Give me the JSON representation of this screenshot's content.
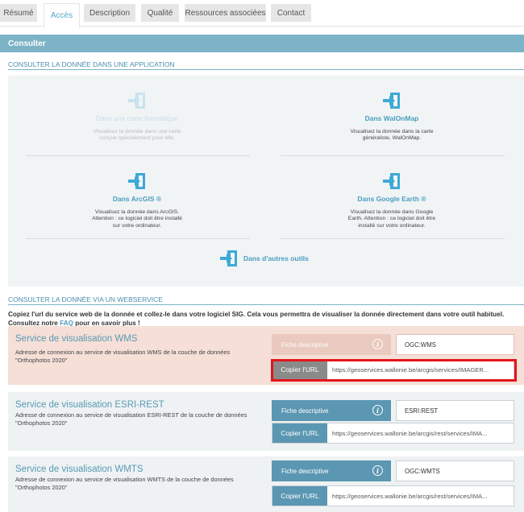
{
  "tabs": [
    {
      "label": "Résumé"
    },
    {
      "label": "Accès"
    },
    {
      "label": "Description"
    },
    {
      "label": "Qualité"
    },
    {
      "label": "Ressources associées"
    },
    {
      "label": "Contact"
    }
  ],
  "consult_bar": "Consulter",
  "section_app": "CONSULTER LA DONNÉE DANS UNE APPLICATION",
  "apps": {
    "thematique": {
      "title": "Dans une carte thématique",
      "desc": "Visualisez la donnée dans une carte conçue spécialement pour elle."
    },
    "walonmap": {
      "title": "Dans WalOnMap",
      "desc": "Visualisez la donnée dans la carte généraliste, WalOnMap."
    },
    "arcgis": {
      "title": "Dans ArcGIS ®",
      "desc": "Visualisez la donnée dans ArcGIS. Attention : ce logiciel doit être installé sur votre ordinateur."
    },
    "google_earth": {
      "title": "Dans Google Earth ®",
      "desc": "Visualisez la donnée dans Google Earth. Attention : ce logiciel doit être installé sur votre ordinateur."
    },
    "autres": {
      "title": "Dans d'autres outils"
    }
  },
  "section_ws": "CONSULTER LA DONNÉE VIA UN WEBSERVICE",
  "intro": {
    "before": "Copiez l'url du service web de la donnée et collez-le dans votre logiciel SIG. Cela vous permettra de visualiser la donnée directement dans votre outil habituel. Consultez notre ",
    "link": "FAQ",
    "after": " pour en savoir plus !"
  },
  "services": {
    "wms": {
      "title": "Service de visualisation WMS",
      "desc": "Adresse de connexion au service de visualisation WMS de la couche de données \"Orthophotos 2020\"",
      "fiche": "Fiche descriptive",
      "type": "OGC:WMS",
      "copy": "Copier l'URL",
      "url": "https://geoservices.wallonie.be/arcgis/services/IMAGER..."
    },
    "esri": {
      "title": "Service de visualisation ESRI-REST",
      "desc": "Adresse de connexion au service de visualisation ESRI-REST de la couche de données \"Orthophotos 2020\"",
      "fiche": "Fiche descriptive",
      "type": "ESRI:REST",
      "copy": "Copier l'URL",
      "url": "https://geoservices.wallonie.be/arcgis/rest/services/IMA..."
    },
    "wmts": {
      "title": "Service de visualisation WMTS",
      "desc": "Adresse de connexion au service de visualisation WMTS de la couche de données \"Orthophotos 2020\"",
      "fiche": "Fiche descriptive",
      "type": "OGC:WMTS",
      "copy": "Copier l'URL",
      "url": "https://geoservices.wallonie.be/arcgis/rest/services/IMA..."
    }
  },
  "colors": {
    "accent": "#5b97b2",
    "highlight": "#f5dfd7",
    "frame": "#e3141b"
  }
}
